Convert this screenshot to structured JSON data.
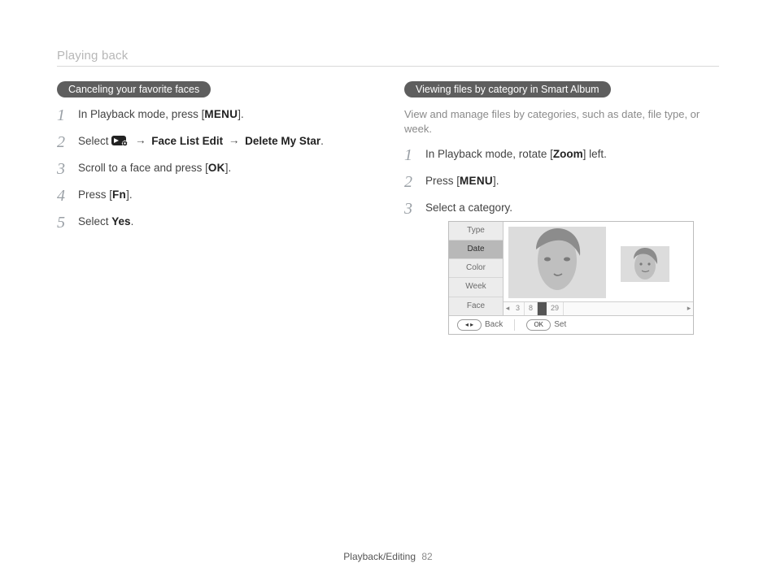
{
  "header": {
    "section": "Playing back"
  },
  "left": {
    "pill": "Canceling your favorite faces",
    "steps": {
      "s1a": "In Playback mode, press [",
      "s1b": "].",
      "menu_label": "MENU",
      "s2a": "Select ",
      "s2b": " Face List Edit ",
      "s2c": " Delete My Star",
      "s2d": ".",
      "s3a": "Scroll to a face and press [",
      "s3b": "].",
      "ok_label": "OK",
      "s4a": "Press [",
      "fn_label": "Fn",
      "s4b": "].",
      "s5a": "Select ",
      "yes_label": "Yes",
      "s5b": "."
    }
  },
  "right": {
    "pill": "Viewing files by category in Smart Album",
    "intro": "View and manage files by categories, such as date, file type, or week.",
    "steps": {
      "s1a": "In Playback mode, rotate [",
      "zoom_label": "Zoom",
      "s1b": "] left.",
      "s2a": "Press [",
      "menu_label": "MENU",
      "s2b": "].",
      "s3": "Select a category."
    }
  },
  "screen": {
    "menu": [
      "Type",
      "Date",
      "Color",
      "Week",
      "Face"
    ],
    "selected_index": 1,
    "film": {
      "a": "3",
      "b": "8",
      "c": "29"
    },
    "footer": {
      "back_btn": "◂ ▸",
      "back_label": "Back",
      "set_btn": "OK",
      "set_label": "Set"
    }
  },
  "footer": {
    "section": "Playback/Editing",
    "page": "82"
  }
}
